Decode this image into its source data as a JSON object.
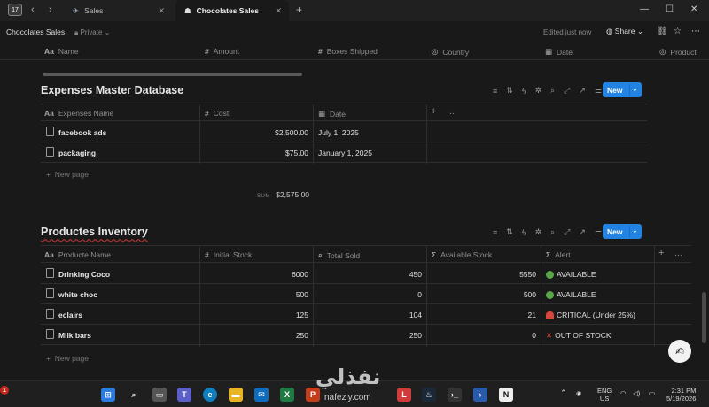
{
  "titlebar": {
    "app_badge": "17",
    "app_badge_count": "1",
    "tabs": [
      {
        "label": "Sales",
        "icon": "plane-icon"
      },
      {
        "label": "Chocolates Sales",
        "icon": "chocolate-icon"
      }
    ],
    "new_tab": "+",
    "controls": [
      "—",
      "☐",
      "✕"
    ]
  },
  "breadcrumb": {
    "title": "Chocolates Sales",
    "privacy": "Private",
    "edited": "Edited just now",
    "share": "Share"
  },
  "sales_columns": [
    {
      "icon": "Aa",
      "label": "Name"
    },
    {
      "icon": "#",
      "label": "Amount"
    },
    {
      "icon": "#",
      "label": "Boxes Shipped"
    },
    {
      "icon": "◎",
      "label": "Country"
    },
    {
      "icon": "▦",
      "label": "Date"
    },
    {
      "icon": "◎",
      "label": "Product"
    }
  ],
  "expenses": {
    "title": "Expenses Master Database",
    "new_label": "New",
    "columns": [
      {
        "icon": "Aa",
        "label": "Expenses Name"
      },
      {
        "icon": "#",
        "label": "Cost"
      },
      {
        "icon": "▦",
        "label": "Date"
      }
    ],
    "rows": [
      {
        "name": "facebook ads",
        "cost": "$2,500.00",
        "date": "July 1, 2025"
      },
      {
        "name": "packaging",
        "cost": "$75.00",
        "date": "January 1, 2025"
      }
    ],
    "new_page": "New page",
    "sum_label": "SUM",
    "sum_value": "$2,575.00"
  },
  "inventory": {
    "title": "Productes Inventory",
    "new_label": "New",
    "columns": [
      {
        "icon": "Aa",
        "label": "Producte Name"
      },
      {
        "icon": "#",
        "label": "Initial Stock"
      },
      {
        "icon": "⌕",
        "label": "Total Sold"
      },
      {
        "icon": "Σ",
        "label": "Available Stock"
      },
      {
        "icon": "Σ",
        "label": "Alert"
      }
    ],
    "rows": [
      {
        "name": "Drinking Coco",
        "initial": "6000",
        "sold": "450",
        "available": "5550",
        "alert": "AVAILABLE",
        "alert_icon": "green-circle-icon"
      },
      {
        "name": "white choc",
        "initial": "500",
        "sold": "0",
        "available": "500",
        "alert": "AVAILABLE",
        "alert_icon": "green-circle-icon"
      },
      {
        "name": "eclairs",
        "initial": "125",
        "sold": "104",
        "available": "21",
        "alert": "CRITICAL (Under 25%)",
        "alert_icon": "siren-icon"
      },
      {
        "name": "Milk bars",
        "initial": "250",
        "sold": "250",
        "available": "0",
        "alert": "OUT OF STOCK",
        "alert_icon": "red-x-icon"
      }
    ],
    "new_page": "New page"
  },
  "taskbar": {
    "lang": "ENG",
    "region": "US",
    "time": "2:31 PM",
    "date": "5/19/2026",
    "watermark": "نفذلي",
    "watermark_sub": "nafezly.com"
  },
  "colors": {
    "accent": "#2383e2",
    "background": "#191919",
    "available": "#5aa547",
    "critical": "#d9463d"
  }
}
